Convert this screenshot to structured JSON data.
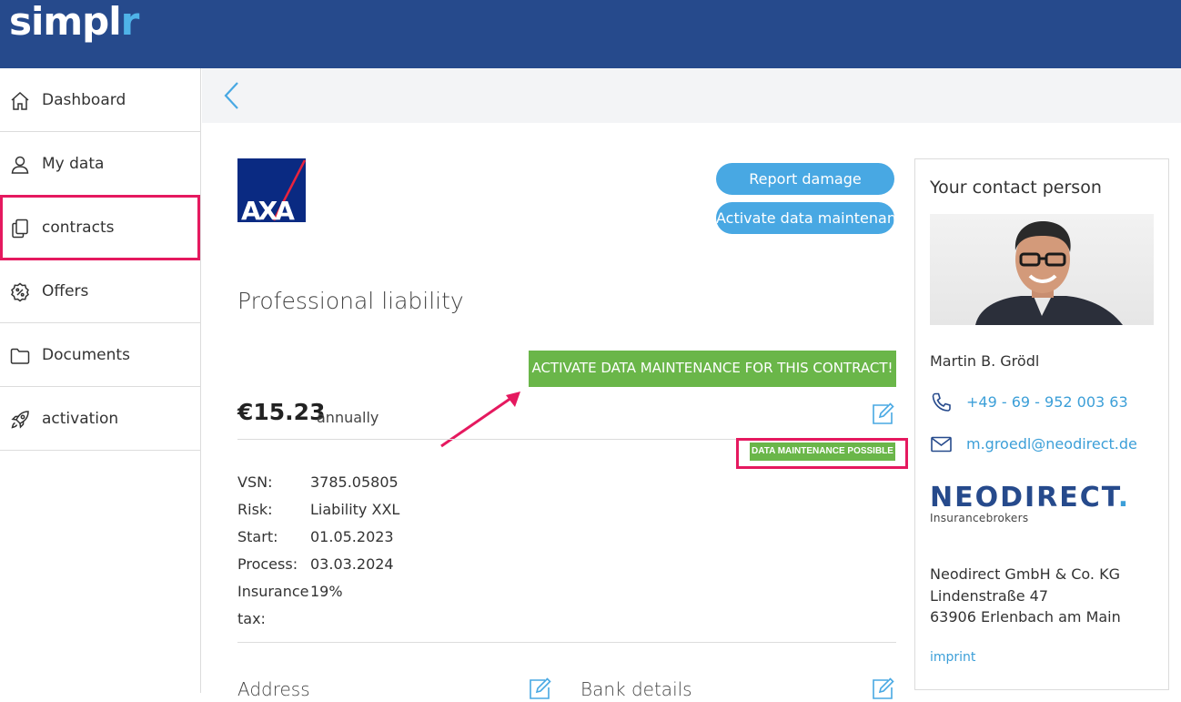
{
  "app": {
    "logo_main": "simpl",
    "logo_accent": "r"
  },
  "sidebar": {
    "items": [
      {
        "label": "Dashboard",
        "icon": "home-icon"
      },
      {
        "label": "My data",
        "icon": "user-icon"
      },
      {
        "label": "contracts",
        "icon": "documents-icon"
      },
      {
        "label": "Offers",
        "icon": "percent-badge-icon"
      },
      {
        "label": "Documents",
        "icon": "folder-icon"
      },
      {
        "label": "activation",
        "icon": "rocket-icon"
      }
    ],
    "highlighted_index": 2
  },
  "contract": {
    "insurer_logo": "AXA",
    "title": "Professional liability",
    "report_damage_label": "Report damage",
    "activate_label": "Activate data maintenance",
    "banner": "ACTIVATE DATA MAINTENANCE FOR THIS CONTRACT!",
    "price": "€15.23",
    "frequency": "annually",
    "badge": "DATA MAINTENANCE POSSIBLE",
    "details": [
      {
        "key": "VSN:",
        "value": "3785.05805"
      },
      {
        "key": "Risk:",
        "value": "Liability XXL"
      },
      {
        "key": "Start:",
        "value": "01.05.2023"
      },
      {
        "key": "Process:",
        "value": "03.03.2024"
      },
      {
        "key": "Insurance",
        "value": "19%"
      },
      {
        "key": "tax:",
        "value": ""
      }
    ],
    "address_heading": "Address",
    "bank_heading": "Bank details"
  },
  "contact": {
    "heading": "Your contact person",
    "name": "Martin B. Grödl",
    "phone": "+49 - 69 - 952 003 63",
    "email": "m.groedl@neodirect.de",
    "brand_main": "NEODIRECT",
    "brand_dot": ".",
    "brand_sub": "Insurancebrokers",
    "address": [
      "Neodirect GmbH & Co. KG",
      "Lindenstraße 47",
      "63906 Erlenbach am Main"
    ],
    "imprint": "imprint"
  },
  "colors": {
    "topbar": "#264a8c",
    "accent": "#48a8e3",
    "green": "#6ab649",
    "highlight": "#e5195f"
  }
}
